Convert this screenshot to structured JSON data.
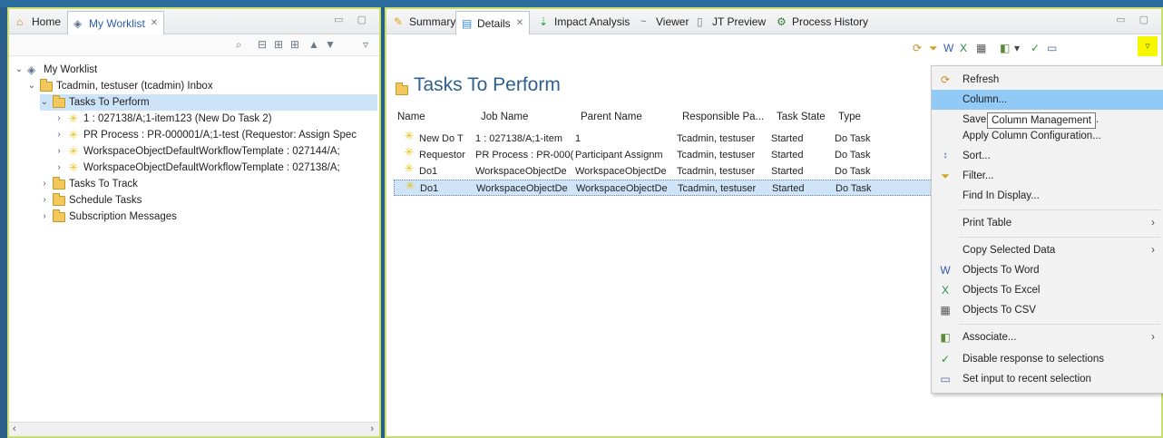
{
  "left_panel": {
    "tabs": [
      {
        "label": "Home",
        "icon": "home-icon"
      },
      {
        "label": "My Worklist",
        "icon": "worklist-icon",
        "close": "✕"
      }
    ],
    "tree": [
      {
        "label": "My Worklist",
        "level": 0,
        "expanded": true,
        "icon": "worklist-icon"
      },
      {
        "label": "Tcadmin, testuser (tcadmin) Inbox",
        "level": 1,
        "expanded": true,
        "icon": "folder-icon"
      },
      {
        "label": "Tasks To Perform",
        "level": 2,
        "expanded": true,
        "icon": "folder-icon",
        "selected": true
      },
      {
        "label": "1 : 027138/A;1-item123 (New Do Task 2)",
        "level": 3,
        "icon": "task-icon"
      },
      {
        "label": "PR Process : PR-000001/A;1-test (Requestor: Assign Spec",
        "level": 3,
        "icon": "task-icon"
      },
      {
        "label": "WorkspaceObjectDefaultWorkflowTemplate : 027144/A;",
        "level": 3,
        "icon": "task-icon"
      },
      {
        "label": "WorkspaceObjectDefaultWorkflowTemplate : 027138/A;",
        "level": 3,
        "icon": "task-icon"
      },
      {
        "label": "Tasks To Track",
        "level": 2,
        "icon": "folder-icon"
      },
      {
        "label": "Schedule Tasks",
        "level": 2,
        "icon": "folder-icon"
      },
      {
        "label": "Subscription Messages",
        "level": 2,
        "icon": "folder-icon"
      }
    ]
  },
  "right_panel": {
    "tabs": [
      {
        "label": "Summary",
        "icon": "summary-icon"
      },
      {
        "label": "Details",
        "icon": "details-icon",
        "close": "✕",
        "active": true
      },
      {
        "label": "Impact Analysis",
        "icon": "impact-analysis-icon"
      },
      {
        "label": "Viewer",
        "icon": "viewer-icon"
      },
      {
        "label": "JT Preview",
        "icon": "jt-preview-icon"
      },
      {
        "label": "Process History",
        "icon": "process-history-icon"
      }
    ],
    "title": "Tasks To Perform",
    "table": {
      "columns": [
        "Name",
        "Job Name",
        "Parent Name",
        "Responsible Pa...",
        "Task State",
        "Type"
      ],
      "rows": [
        [
          "New Do T",
          "1 : 027138/A;1-item",
          "1",
          "Tcadmin, testuser",
          "Started",
          "Do Task"
        ],
        [
          "Requestor",
          "PR Process : PR-000(",
          "Participant Assignm",
          "Tcadmin, testuser",
          "Started",
          "Do Task"
        ],
        [
          "Do1",
          "WorkspaceObjectDe",
          "WorkspaceObjectDe",
          "Tcadmin, testuser",
          "Started",
          "Do Task"
        ],
        [
          "Do1",
          "WorkspaceObjectDe",
          "WorkspaceObjectDe",
          "Tcadmin, testuser",
          "Started",
          "Do Task"
        ]
      ],
      "selected_row": 3
    }
  },
  "context_menu": {
    "items": [
      {
        "label": "Refresh",
        "icon": "refresh-icon"
      },
      {
        "label": "Column...",
        "highlighted": true
      },
      {
        "label": "Save Column Configuration..."
      },
      {
        "label": "Apply Column Configuration..."
      },
      {
        "label": "Sort...",
        "icon": "sort-icon"
      },
      {
        "label": "Filter...",
        "icon": "filter-icon"
      },
      {
        "label": "Find In Display..."
      },
      {
        "separator": true
      },
      {
        "label": "Print Table",
        "submenu": true
      },
      {
        "separator": true
      },
      {
        "label": "Copy Selected Data",
        "submenu": true
      },
      {
        "label": "Objects To Word",
        "icon": "word-icon"
      },
      {
        "label": "Objects To Excel",
        "icon": "excel-icon"
      },
      {
        "label": "Objects To CSV",
        "icon": "csv-icon"
      },
      {
        "separator": true
      },
      {
        "label": "Associate...",
        "icon": "associate-icon",
        "submenu": true
      },
      {
        "label": "Disable response to selections",
        "icon": "disable-response-icon"
      },
      {
        "label": "Set input to recent selection",
        "icon": "recent-selection-icon"
      }
    ]
  },
  "tooltip": {
    "text": "Column Management"
  },
  "colors": {
    "accent_border": "#c8de6e",
    "highlight": "#91c9f7",
    "selection": "#cde3f7",
    "title": "#2e5f8e",
    "view_menu": "#f7f700"
  }
}
